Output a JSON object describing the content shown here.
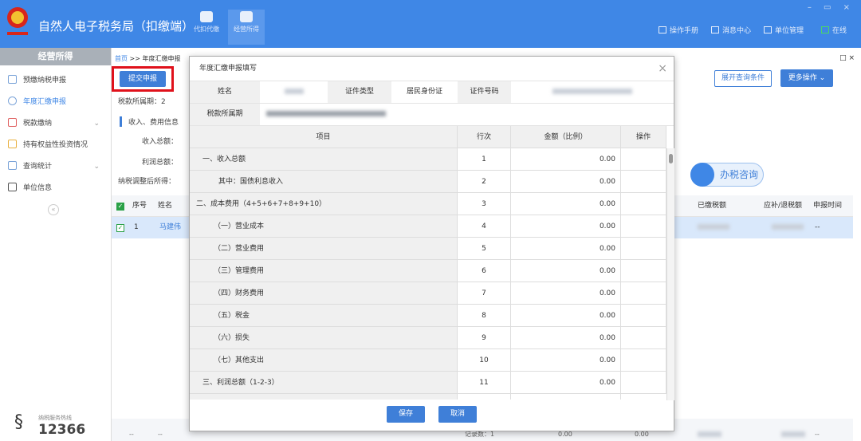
{
  "header": {
    "app_title": "自然人电子税务局（扣缴端）",
    "nav": [
      {
        "label": "代扣代缴",
        "icon": "wallet-icon"
      },
      {
        "label": "经营所得",
        "icon": "coins-icon"
      }
    ],
    "links": [
      {
        "label": "操作手册",
        "icon": "manual-icon"
      },
      {
        "label": "消息中心",
        "icon": "message-icon"
      },
      {
        "label": "单位管理",
        "icon": "building-icon"
      },
      {
        "label": "在线",
        "icon": "monitor-icon"
      }
    ],
    "window_controls": "– ▭ ×"
  },
  "sidebar": {
    "title": "经营所得",
    "items": [
      {
        "label": "预缴纳税申报"
      },
      {
        "label": "年度汇缴申报"
      },
      {
        "label": "税款缴纳"
      },
      {
        "label": "持有权益性投资情况"
      },
      {
        "label": "查询统计"
      },
      {
        "label": "单位信息"
      }
    ],
    "collapse": "«",
    "hotline_label": "纳税服务热线",
    "hotline_number": "12366"
  },
  "main": {
    "breadcrumb_home": "首页",
    "breadcrumb_sep": " >> ",
    "breadcrumb_current": "年度汇缴申报",
    "tab_controls": "□ ×",
    "submit": "提交申报",
    "expand": "展开查询条件",
    "more": "更多操作 ⌄",
    "period_label": "税款所属期：2",
    "section": "收入、费用信息",
    "income_label": "收入总额：",
    "profit_label": "利润总额：",
    "adjusted_label": "纳税调整后所得：",
    "consult": "办税咨询",
    "table_headers": {
      "seq": "序号",
      "name": "姓名",
      "paid": "已缴税额",
      "refund": "应补/退税额",
      "time": "申报时间"
    },
    "row": {
      "seq": "1",
      "name": "马建伟",
      "time": "--"
    },
    "footer": {
      "dash": "--",
      "count": "记录数：1",
      "v1": "0.00",
      "v2": "0.00"
    }
  },
  "modal": {
    "title": "年度汇缴申报填写",
    "close": "×",
    "name_label": "姓名",
    "id_type_label": "证件类型",
    "id_type": "居民身份证",
    "id_no_label": "证件号码",
    "period_label": "税款所属期",
    "columns": [
      "项目",
      "行次",
      "金额（比例）",
      "操作"
    ],
    "rows": [
      {
        "item": "一、收入总额",
        "line": "1",
        "amount": "0.00"
      },
      {
        "item": "其中：国债利息收入",
        "line": "2",
        "amount": "0.00"
      },
      {
        "item": "二、成本费用（4+5+6+7+8+9+10）",
        "line": "3",
        "amount": "0.00"
      },
      {
        "item": "（一）营业成本",
        "line": "4",
        "amount": "0.00"
      },
      {
        "item": "（二）营业费用",
        "line": "5",
        "amount": "0.00"
      },
      {
        "item": "（三）管理费用",
        "line": "6",
        "amount": "0.00"
      },
      {
        "item": "（四）财务费用",
        "line": "7",
        "amount": "0.00"
      },
      {
        "item": "（五）税金",
        "line": "8",
        "amount": "0.00"
      },
      {
        "item": "（六）损失",
        "line": "9",
        "amount": "0.00"
      },
      {
        "item": "（七）其他支出",
        "line": "10",
        "amount": "0.00"
      },
      {
        "item": "三、利润总额（1-2-3）",
        "line": "11",
        "amount": "0.00"
      }
    ],
    "save": "保存",
    "cancel": "取消"
  },
  "colors": {
    "header": "#3f87e6",
    "accent": "#3f7fd8",
    "highlight": "#e0111b"
  }
}
